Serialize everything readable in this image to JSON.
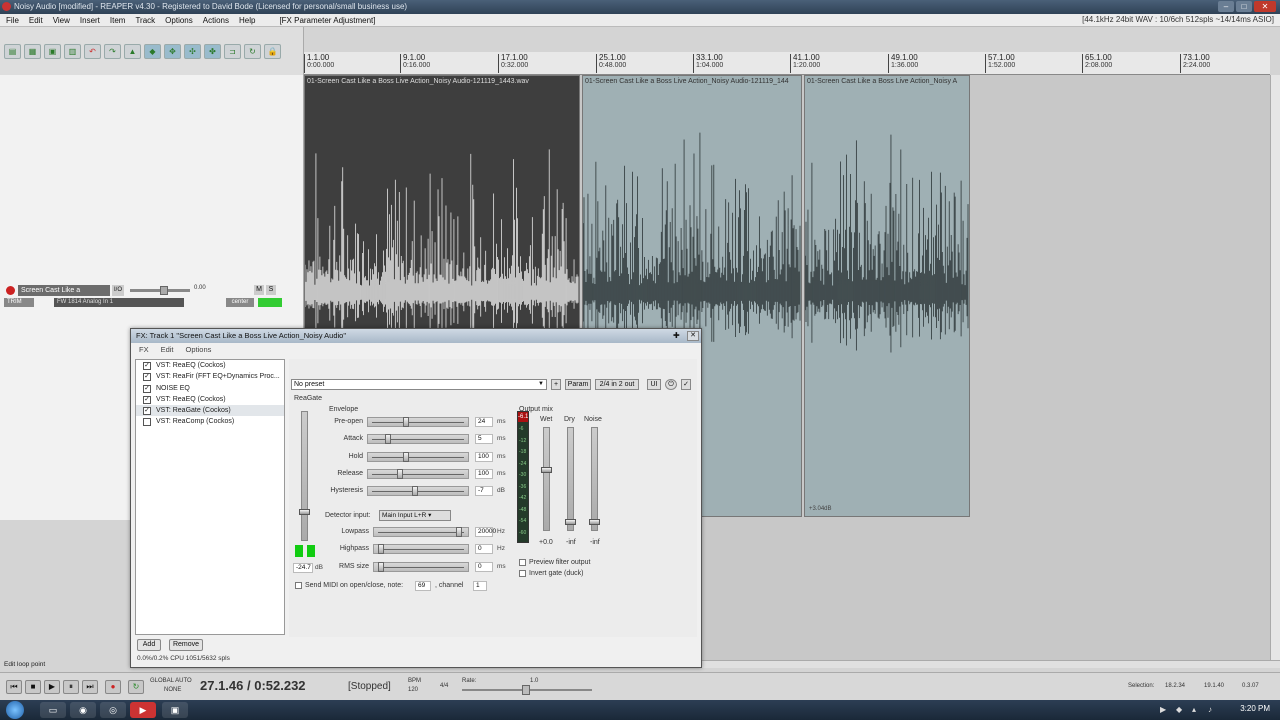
{
  "window": {
    "title": "Noisy Audio [modified] - REAPER v4.30 - Registered to David Bode (Licensed for personal/small business use)",
    "buttons": [
      "–",
      "□",
      "✕"
    ]
  },
  "menubar": {
    "items": [
      "File",
      "Edit",
      "View",
      "Insert",
      "Item",
      "Track",
      "Options",
      "Actions",
      "Help"
    ],
    "extra": "[FX Parameter Adjustment]",
    "status": "[44.1kHz 24bit WAV : 10/6ch 512spls ~14/14ms ASIO]"
  },
  "ruler": {
    "ticks": [
      {
        "bar": "1.1.00",
        "time": "0:00.000"
      },
      {
        "bar": "9.1.00",
        "time": "0:16.000"
      },
      {
        "bar": "17.1.00",
        "time": "0:32.000"
      },
      {
        "bar": "25.1.00",
        "time": "0:48.000"
      },
      {
        "bar": "33.1.00",
        "time": "1:04.000"
      },
      {
        "bar": "41.1.00",
        "time": "1:20.000"
      },
      {
        "bar": "49.1.00",
        "time": "1:36.000"
      },
      {
        "bar": "57.1.00",
        "time": "1:52.000"
      },
      {
        "bar": "65.1.00",
        "time": "2:08.000"
      },
      {
        "bar": "73.1.00",
        "time": "2:24.000"
      }
    ]
  },
  "items": {
    "item1": "01-Screen Cast Like a Boss Live Action_Noisy Audio-121119_1443.wav",
    "item2": "01-Screen Cast Like a Boss Live Action_Noisy Audio-121119_144",
    "item3": "01-Screen Cast Like a Boss Live Action_Noisy A",
    "item3_gain": "+3.04dB"
  },
  "track": {
    "name": "Screen Cast Like a",
    "io": "I/O",
    "volume": "0.00",
    "mute": "M",
    "solo": "S",
    "trim": "TRIM",
    "input": "FW 1814 Analog In 1",
    "pan": "center"
  },
  "fx": {
    "title": "FX: Track 1 \"Screen Cast Like a Boss Live Action_Noisy Audio\"",
    "menu": [
      "FX",
      "Edit",
      "Options"
    ],
    "chain": [
      {
        "name": "VST: ReaEQ (Cockos)",
        "checked": "✓"
      },
      {
        "name": "VST: ReaFir (FFT EQ+Dynamics Proc...",
        "checked": "✓"
      },
      {
        "name": "NOISE EQ",
        "checked": "✓"
      },
      {
        "name": "VST: ReaEQ (Cockos)",
        "checked": "✓"
      },
      {
        "name": "VST: ReaGate (Cockos)",
        "checked": "✓"
      },
      {
        "name": "VST: ReaComp (Cockos)",
        "checked": ""
      }
    ],
    "add": "Add",
    "remove": "Remove",
    "cpu": "0.0%/0.2% CPU 1051/5632 spls"
  },
  "plugin": {
    "preset": "No preset",
    "plus": "+",
    "param": "Param",
    "io": "2/4 in 2 out",
    "ui": "UI",
    "name": "ReaGate",
    "envelope": "Envelope",
    "params": [
      {
        "label": "Pre-open",
        "value": "24",
        "unit": "ms",
        "pos": 0.35
      },
      {
        "label": "Attack",
        "value": "5",
        "unit": "ms",
        "pos": 0.15
      },
      {
        "label": "Hold",
        "value": "100",
        "unit": "ms",
        "pos": 0.35
      },
      {
        "label": "Release",
        "value": "100",
        "unit": "ms",
        "pos": 0.28
      },
      {
        "label": "Hysteresis",
        "value": "-7",
        "unit": "dB",
        "pos": 0.45
      }
    ],
    "detector_label": "Detector input:",
    "detector_value": "Main Input L+R",
    "filters": [
      {
        "label": "Lowpass",
        "value": "20000",
        "unit": "Hz",
        "pos": 0.95
      },
      {
        "label": "Highpass",
        "value": "0",
        "unit": "Hz",
        "pos": 0.0
      },
      {
        "label": "RMS size",
        "value": "0",
        "unit": "ms",
        "pos": 0.0
      }
    ],
    "threshold": "-24.7",
    "threshold_unit": "dB",
    "output_mix": "Output mix",
    "wet": "Wet",
    "dry": "Dry",
    "noise": "Noise",
    "clip": "-6.1",
    "meter_scale": [
      "-6",
      "-12",
      "-18",
      "-24",
      "-30",
      "-36",
      "-42",
      "-48",
      "-54",
      "-60"
    ],
    "wet_val": "+0.0",
    "dry_val": "-inf",
    "noise_val": "-inf",
    "preview": "Preview filter output",
    "invert": "Invert gate (duck)",
    "midi_label": "Send MIDI on open/close, note:",
    "midi_note": "69",
    "channel_label": ", channel",
    "channel": "1"
  },
  "transport": {
    "time": "27.1.46 / 0:52.232",
    "state": "[Stopped]",
    "bpm_label": "BPM",
    "bpm": "120",
    "sig": "4/4",
    "rate_label": "Rate:",
    "rate": "1.0",
    "global_auto": "GLOBAL AUTO",
    "none": "NONE",
    "selection_label": "Selection:",
    "sel_start": "18.2.34",
    "sel_end": "19.1.40",
    "sel_len": "0.3.07"
  },
  "status": {
    "edit_loop": "Edit loop point"
  },
  "taskbar": {
    "clock": "3:20 PM"
  }
}
